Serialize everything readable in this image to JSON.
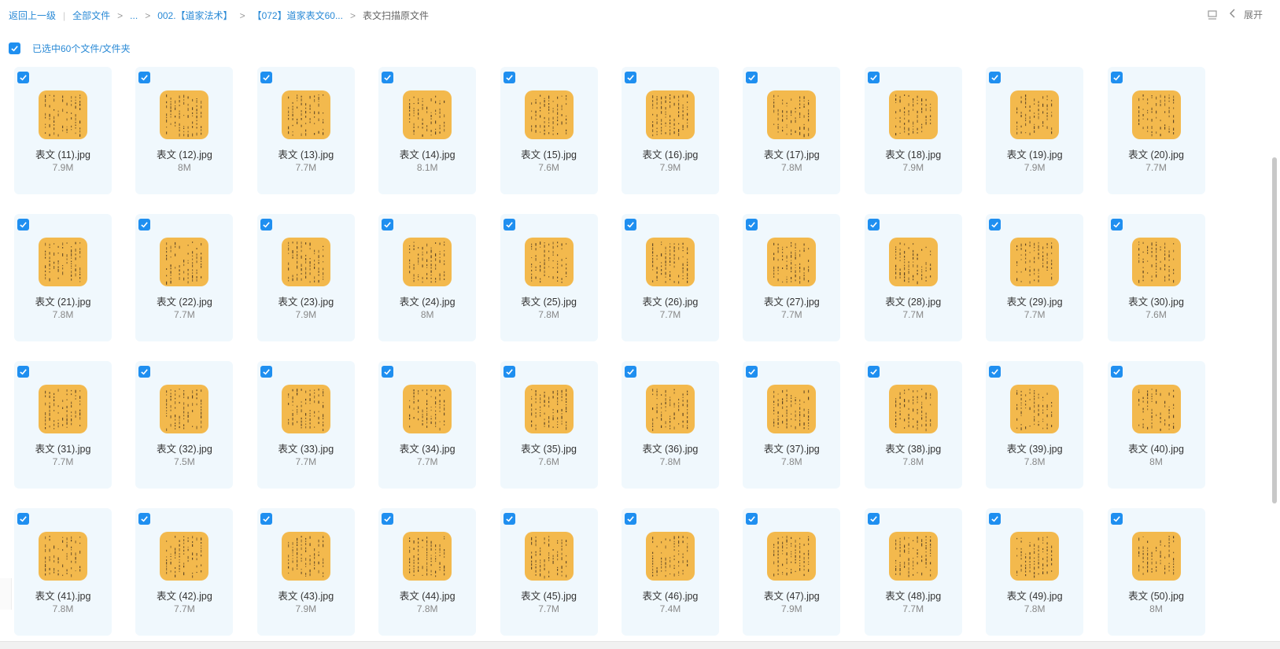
{
  "breadcrumb": {
    "back": "返回上一级",
    "root": "全部文件",
    "ellipsis": "...",
    "folder1": "002.【道家法术】",
    "folder2": "【072】道家表文60...",
    "current": "表文扫描原文件"
  },
  "toolbar": {
    "expand_label": "展开"
  },
  "selection": {
    "label": "已选中60个文件/文件夹"
  },
  "colors": {
    "accent": "#1f8ff0",
    "card_bg": "#f0f8fd",
    "thumb": "#f3b94d"
  },
  "files": [
    {
      "name": "表文 (11).jpg",
      "size": "7.9M"
    },
    {
      "name": "表文 (12).jpg",
      "size": "8M"
    },
    {
      "name": "表文 (13).jpg",
      "size": "7.7M"
    },
    {
      "name": "表文 (14).jpg",
      "size": "8.1M"
    },
    {
      "name": "表文 (15).jpg",
      "size": "7.6M"
    },
    {
      "name": "表文 (16).jpg",
      "size": "7.9M"
    },
    {
      "name": "表文 (17).jpg",
      "size": "7.8M"
    },
    {
      "name": "表文 (18).jpg",
      "size": "7.9M"
    },
    {
      "name": "表文 (19).jpg",
      "size": "7.9M"
    },
    {
      "name": "表文 (20).jpg",
      "size": "7.7M"
    },
    {
      "name": "表文 (21).jpg",
      "size": "7.8M"
    },
    {
      "name": "表文 (22).jpg",
      "size": "7.7M"
    },
    {
      "name": "表文 (23).jpg",
      "size": "7.9M"
    },
    {
      "name": "表文 (24).jpg",
      "size": "8M"
    },
    {
      "name": "表文 (25).jpg",
      "size": "7.8M"
    },
    {
      "name": "表文 (26).jpg",
      "size": "7.7M"
    },
    {
      "name": "表文 (27).jpg",
      "size": "7.7M"
    },
    {
      "name": "表文 (28).jpg",
      "size": "7.7M"
    },
    {
      "name": "表文 (29).jpg",
      "size": "7.7M"
    },
    {
      "name": "表文 (30).jpg",
      "size": "7.6M"
    },
    {
      "name": "表文 (31).jpg",
      "size": "7.7M"
    },
    {
      "name": "表文 (32).jpg",
      "size": "7.5M"
    },
    {
      "name": "表文 (33).jpg",
      "size": "7.7M"
    },
    {
      "name": "表文 (34).jpg",
      "size": "7.7M"
    },
    {
      "name": "表文 (35).jpg",
      "size": "7.6M"
    },
    {
      "name": "表文 (36).jpg",
      "size": "7.8M"
    },
    {
      "name": "表文 (37).jpg",
      "size": "7.8M"
    },
    {
      "name": "表文 (38).jpg",
      "size": "7.8M"
    },
    {
      "name": "表文 (39).jpg",
      "size": "7.8M"
    },
    {
      "name": "表文 (40).jpg",
      "size": "8M"
    },
    {
      "name": "表文 (41).jpg",
      "size": "7.8M"
    },
    {
      "name": "表文 (42).jpg",
      "size": "7.7M"
    },
    {
      "name": "表文 (43).jpg",
      "size": "7.9M"
    },
    {
      "name": "表文 (44).jpg",
      "size": "7.8M"
    },
    {
      "name": "表文 (45).jpg",
      "size": "7.7M"
    },
    {
      "name": "表文 (46).jpg",
      "size": "7.4M"
    },
    {
      "name": "表文 (47).jpg",
      "size": "7.9M"
    },
    {
      "name": "表文 (48).jpg",
      "size": "7.7M"
    },
    {
      "name": "表文 (49).jpg",
      "size": "7.8M"
    },
    {
      "name": "表文 (50).jpg",
      "size": "8M"
    }
  ]
}
